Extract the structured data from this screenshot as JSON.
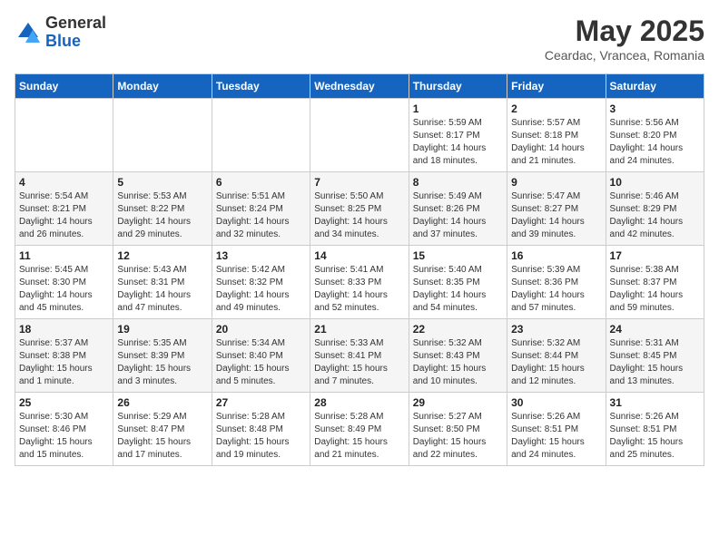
{
  "logo": {
    "general": "General",
    "blue": "Blue"
  },
  "title": "May 2025",
  "subtitle": "Ceardac, Vrancea, Romania",
  "days_of_week": [
    "Sunday",
    "Monday",
    "Tuesday",
    "Wednesday",
    "Thursday",
    "Friday",
    "Saturday"
  ],
  "weeks": [
    [
      {
        "day": "",
        "info": ""
      },
      {
        "day": "",
        "info": ""
      },
      {
        "day": "",
        "info": ""
      },
      {
        "day": "",
        "info": ""
      },
      {
        "day": "1",
        "info": "Sunrise: 5:59 AM\nSunset: 8:17 PM\nDaylight: 14 hours\nand 18 minutes."
      },
      {
        "day": "2",
        "info": "Sunrise: 5:57 AM\nSunset: 8:18 PM\nDaylight: 14 hours\nand 21 minutes."
      },
      {
        "day": "3",
        "info": "Sunrise: 5:56 AM\nSunset: 8:20 PM\nDaylight: 14 hours\nand 24 minutes."
      }
    ],
    [
      {
        "day": "4",
        "info": "Sunrise: 5:54 AM\nSunset: 8:21 PM\nDaylight: 14 hours\nand 26 minutes."
      },
      {
        "day": "5",
        "info": "Sunrise: 5:53 AM\nSunset: 8:22 PM\nDaylight: 14 hours\nand 29 minutes."
      },
      {
        "day": "6",
        "info": "Sunrise: 5:51 AM\nSunset: 8:24 PM\nDaylight: 14 hours\nand 32 minutes."
      },
      {
        "day": "7",
        "info": "Sunrise: 5:50 AM\nSunset: 8:25 PM\nDaylight: 14 hours\nand 34 minutes."
      },
      {
        "day": "8",
        "info": "Sunrise: 5:49 AM\nSunset: 8:26 PM\nDaylight: 14 hours\nand 37 minutes."
      },
      {
        "day": "9",
        "info": "Sunrise: 5:47 AM\nSunset: 8:27 PM\nDaylight: 14 hours\nand 39 minutes."
      },
      {
        "day": "10",
        "info": "Sunrise: 5:46 AM\nSunset: 8:29 PM\nDaylight: 14 hours\nand 42 minutes."
      }
    ],
    [
      {
        "day": "11",
        "info": "Sunrise: 5:45 AM\nSunset: 8:30 PM\nDaylight: 14 hours\nand 45 minutes."
      },
      {
        "day": "12",
        "info": "Sunrise: 5:43 AM\nSunset: 8:31 PM\nDaylight: 14 hours\nand 47 minutes."
      },
      {
        "day": "13",
        "info": "Sunrise: 5:42 AM\nSunset: 8:32 PM\nDaylight: 14 hours\nand 49 minutes."
      },
      {
        "day": "14",
        "info": "Sunrise: 5:41 AM\nSunset: 8:33 PM\nDaylight: 14 hours\nand 52 minutes."
      },
      {
        "day": "15",
        "info": "Sunrise: 5:40 AM\nSunset: 8:35 PM\nDaylight: 14 hours\nand 54 minutes."
      },
      {
        "day": "16",
        "info": "Sunrise: 5:39 AM\nSunset: 8:36 PM\nDaylight: 14 hours\nand 57 minutes."
      },
      {
        "day": "17",
        "info": "Sunrise: 5:38 AM\nSunset: 8:37 PM\nDaylight: 14 hours\nand 59 minutes."
      }
    ],
    [
      {
        "day": "18",
        "info": "Sunrise: 5:37 AM\nSunset: 8:38 PM\nDaylight: 15 hours\nand 1 minute."
      },
      {
        "day": "19",
        "info": "Sunrise: 5:35 AM\nSunset: 8:39 PM\nDaylight: 15 hours\nand 3 minutes."
      },
      {
        "day": "20",
        "info": "Sunrise: 5:34 AM\nSunset: 8:40 PM\nDaylight: 15 hours\nand 5 minutes."
      },
      {
        "day": "21",
        "info": "Sunrise: 5:33 AM\nSunset: 8:41 PM\nDaylight: 15 hours\nand 7 minutes."
      },
      {
        "day": "22",
        "info": "Sunrise: 5:32 AM\nSunset: 8:43 PM\nDaylight: 15 hours\nand 10 minutes."
      },
      {
        "day": "23",
        "info": "Sunrise: 5:32 AM\nSunset: 8:44 PM\nDaylight: 15 hours\nand 12 minutes."
      },
      {
        "day": "24",
        "info": "Sunrise: 5:31 AM\nSunset: 8:45 PM\nDaylight: 15 hours\nand 13 minutes."
      }
    ],
    [
      {
        "day": "25",
        "info": "Sunrise: 5:30 AM\nSunset: 8:46 PM\nDaylight: 15 hours\nand 15 minutes."
      },
      {
        "day": "26",
        "info": "Sunrise: 5:29 AM\nSunset: 8:47 PM\nDaylight: 15 hours\nand 17 minutes."
      },
      {
        "day": "27",
        "info": "Sunrise: 5:28 AM\nSunset: 8:48 PM\nDaylight: 15 hours\nand 19 minutes."
      },
      {
        "day": "28",
        "info": "Sunrise: 5:28 AM\nSunset: 8:49 PM\nDaylight: 15 hours\nand 21 minutes."
      },
      {
        "day": "29",
        "info": "Sunrise: 5:27 AM\nSunset: 8:50 PM\nDaylight: 15 hours\nand 22 minutes."
      },
      {
        "day": "30",
        "info": "Sunrise: 5:26 AM\nSunset: 8:51 PM\nDaylight: 15 hours\nand 24 minutes."
      },
      {
        "day": "31",
        "info": "Sunrise: 5:26 AM\nSunset: 8:51 PM\nDaylight: 15 hours\nand 25 minutes."
      }
    ]
  ]
}
